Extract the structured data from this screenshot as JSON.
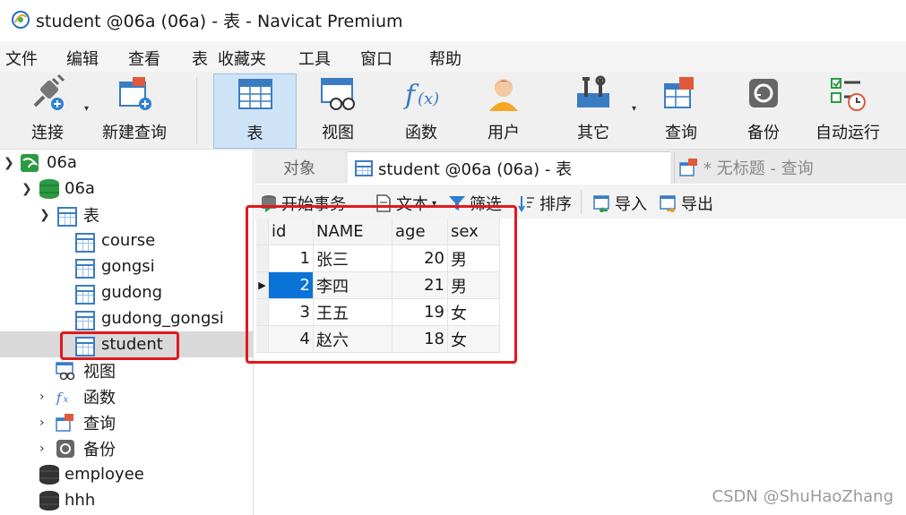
{
  "window": {
    "title": "student @06a (06a) - 表 - Navicat Premium"
  },
  "menu": [
    "文件",
    "编辑",
    "查看",
    "表",
    "收藏夹",
    "工具",
    "窗口",
    "帮助"
  ],
  "toolbar": {
    "connect": "连接",
    "new_query": "新建查询",
    "table": "表",
    "view": "视图",
    "function": "函数",
    "user": "用户",
    "other": "其它",
    "query": "查询",
    "backup": "备份",
    "automation": "自动运行"
  },
  "tree": {
    "connection": "06a",
    "database": "06a",
    "tables_folder": "表",
    "tables": [
      "course",
      "gongsi",
      "gudong",
      "gudong_gongsi",
      "student"
    ],
    "views": "视图",
    "functions": "函数",
    "queries": "查询",
    "backups": "备份",
    "other_dbs": [
      "employee",
      "hhh"
    ]
  },
  "tabs": {
    "objects": "对象",
    "current": "student @06a (06a) - 表",
    "untitled": "* 无标题 - 查询"
  },
  "subtoolbar": {
    "begin_txn": "开始事务",
    "text": "文本",
    "filter": "筛选",
    "sort": "排序",
    "import": "导入",
    "export": "导出"
  },
  "grid": {
    "columns": [
      "id",
      "NAME",
      "age",
      "sex"
    ],
    "rows": [
      [
        "1",
        "张三",
        "20",
        "男"
      ],
      [
        "2",
        "李四",
        "21",
        "男"
      ],
      [
        "3",
        "王五",
        "19",
        "女"
      ],
      [
        "4",
        "赵六",
        "18",
        "女"
      ]
    ]
  },
  "watermark": "CSDN @ShuHaoZhang",
  "colors": {
    "highlight": "#e0191d",
    "selection": "#0a73d8",
    "active_tool": "#cfe3f7"
  }
}
